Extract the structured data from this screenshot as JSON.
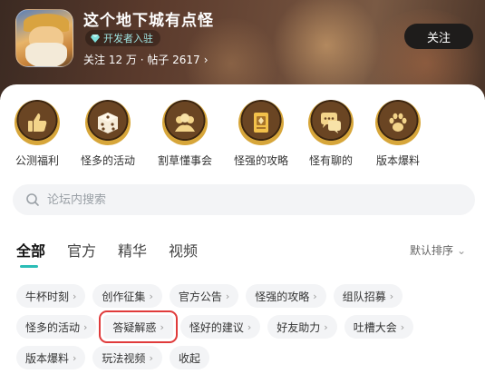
{
  "header": {
    "game_title": "这个地下城有点怪",
    "dev_badge": "开发者入驻",
    "stats": "关注 12 万 · 帖子 2617",
    "stats_chevron": "›",
    "follow_label": "关注",
    "colors": {
      "badge_text": "#9fe3e0",
      "follow_bg": "#1e1c1b"
    }
  },
  "categories": [
    {
      "label": "公测福利",
      "icon": "thumbs-up-icon"
    },
    {
      "label": "怪多的活动",
      "icon": "dice-icon"
    },
    {
      "label": "割草懂事会",
      "icon": "group-icon"
    },
    {
      "label": "怪强的攻略",
      "icon": "guide-book-icon"
    },
    {
      "label": "怪有聊的",
      "icon": "chat-bubble-icon"
    },
    {
      "label": "版本爆料",
      "icon": "paw-icon"
    }
  ],
  "search": {
    "placeholder": "论坛内搜索"
  },
  "tabs": [
    {
      "label": "全部",
      "active": true
    },
    {
      "label": "官方",
      "active": false
    },
    {
      "label": "精华",
      "active": false
    },
    {
      "label": "视频",
      "active": false
    }
  ],
  "sort": {
    "label": "默认排序",
    "chevron": "⌄"
  },
  "tags": {
    "row1": [
      "牛杯时刻",
      "创作征集",
      "官方公告",
      "怪强的攻略",
      "组队招募"
    ],
    "row2": [
      "怪多的活动",
      "答疑解惑",
      "怪好的建议",
      "好友助力",
      "吐槽大会"
    ],
    "row3": [
      "版本爆料",
      "玩法视频"
    ],
    "collapse_label": "收起",
    "chevron": "›",
    "highlighted": "答疑解惑"
  },
  "accent_color": "#2bbdb6",
  "highlight_color": "#e03b3b"
}
